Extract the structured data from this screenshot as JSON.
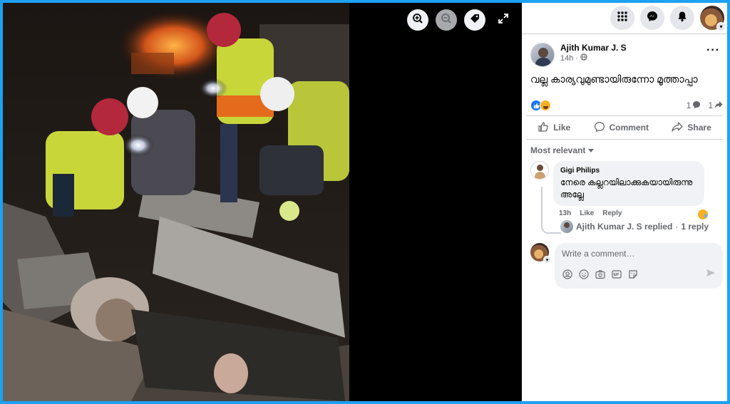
{
  "viewer": {
    "tools": {
      "zoom_in": "zoom-in-icon",
      "zoom_out": "zoom-out-icon",
      "tag": "tag-icon",
      "fullscreen": "fullscreen-icon"
    }
  },
  "topbar": {
    "icons": [
      "menu-grid-icon",
      "messenger-icon",
      "notifications-bell-icon"
    ]
  },
  "post": {
    "author": "Ajith Kumar J. S",
    "time": "14h",
    "privacy_icon": "globe-icon",
    "text": "വല്ല കാര്യവുമുണ്ടായിരുന്നോ മൂത്താപ്പാ",
    "reactions": [
      "like",
      "haha"
    ],
    "comment_count": "1",
    "share_count": "1"
  },
  "actions": {
    "like": "Like",
    "comment": "Comment",
    "share": "Share"
  },
  "comments_filter": "Most relevant",
  "comment": {
    "name": "Gigi Philips",
    "text": "നേരെ കല്ലറയിലാക്കുകയായിരുന്നു അല്ലേ",
    "time": "13h",
    "like": "Like",
    "reply": "Reply",
    "reaction": "sad"
  },
  "replies": {
    "text": "Ajith Kumar J. S replied",
    "separator": "·",
    "count": "1 reply"
  },
  "composer": {
    "placeholder": "Write a comment…"
  },
  "colors": {
    "accent": "#1877f2",
    "border": "#1da1f2",
    "bubble": "#f0f2f5",
    "muted": "#65676b"
  }
}
